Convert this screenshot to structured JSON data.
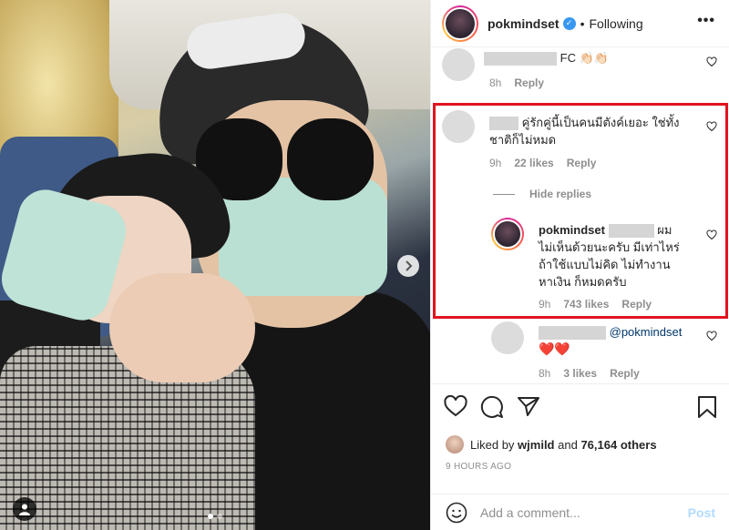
{
  "post": {
    "username": "pokmindset",
    "separator": "•",
    "follow_status": "Following",
    "more_label": "•••"
  },
  "comments": [
    {
      "text_suffix": "FC 👏🏻👏🏻",
      "age": "8h",
      "reply": "Reply"
    },
    {
      "text": "คู่รักคู่นี้เป็นคนมีตังค์เยอะ ใช่ทั้งชาติก็ไม่หมด",
      "age": "9h",
      "likes": "22 likes",
      "reply": "Reply",
      "hide_replies": "Hide replies"
    },
    {
      "author": "pokmindset",
      "text": "ผมไม่เห็นด้วยนะครับ มีเท่าไหร่ถ้าใช้แบบไม่คิด ไม่ทำงานหาเงิน ก็หมดครับ",
      "age": "9h",
      "likes": "743 likes",
      "reply": "Reply"
    },
    {
      "mention": "@pokmindset",
      "hearts": "❤️❤️",
      "age": "8h",
      "likes": "3 likes",
      "reply": "Reply"
    }
  ],
  "liked_by": {
    "prefix": "Liked by",
    "user": "wjmild",
    "and": "and",
    "count": "76,164 others"
  },
  "timestamp": "9 HOURS AGO",
  "comment_box": {
    "placeholder": "Add a comment...",
    "post_label": "Post"
  },
  "icons": [
    "heart-icon",
    "comment-icon",
    "share-icon",
    "bookmark-icon",
    "emoji-icon",
    "chevron-right-icon",
    "user-tag-icon"
  ],
  "colors": {
    "verified": "#3897f0",
    "highlight": "#e0141e",
    "post_button": "#b3dbff"
  }
}
